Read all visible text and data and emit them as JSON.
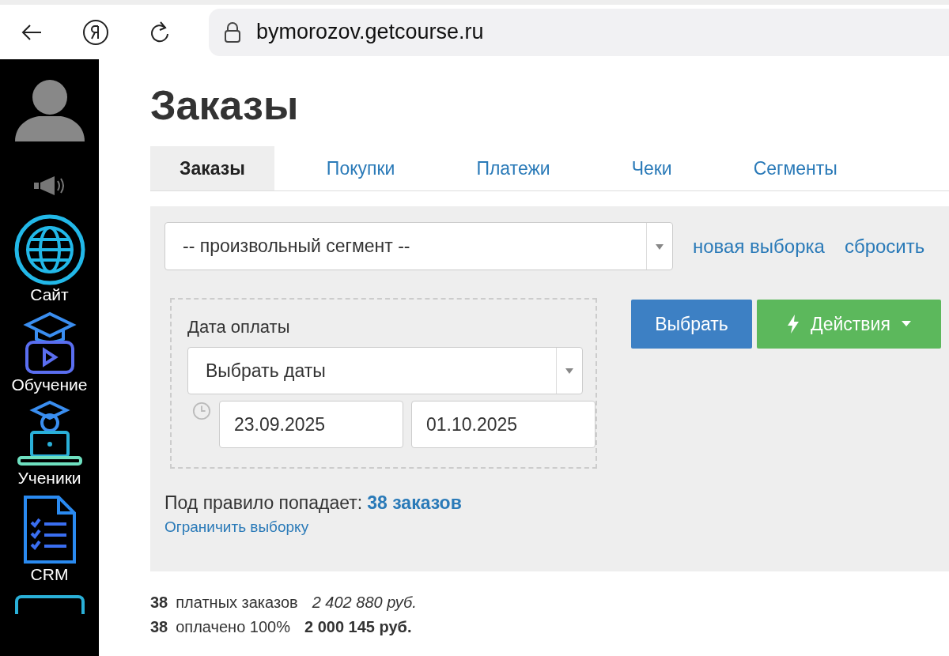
{
  "browser": {
    "url": "bymorozov.getcourse.ru"
  },
  "sidebar": {
    "items": [
      {
        "label": "Сайт",
        "kind": "globe"
      },
      {
        "label": "Обучение",
        "kind": "course"
      },
      {
        "label": "Ученики",
        "kind": "students"
      },
      {
        "label": "CRM",
        "kind": "crm"
      }
    ]
  },
  "page": {
    "title": "Заказы"
  },
  "tabs": [
    {
      "label": "Заказы",
      "selected": true
    },
    {
      "label": "Покупки",
      "selected": false
    },
    {
      "label": "Платежи",
      "selected": false
    },
    {
      "label": "Чеки",
      "selected": false
    },
    {
      "label": "Сегменты",
      "selected": false
    }
  ],
  "filter": {
    "segment": "-- произвольный сегмент --",
    "links": [
      "новая выборка",
      "сбросить"
    ],
    "date_block": {
      "label": "Дата оплаты",
      "select": "Выбрать даты",
      "from": "23.09.2025",
      "to": "01.10.2025"
    },
    "buttons": [
      {
        "label": "Выбрать",
        "kind": "primary"
      },
      {
        "label": "Действия",
        "kind": "actions"
      }
    ],
    "rule_text": "Под правило попадает:",
    "rule_count": "38 заказов",
    "limit_link": "Ограничить выборку"
  },
  "stats": [
    {
      "count": "38",
      "label": "платных заказов",
      "amount": "2 402 880 руб.",
      "kind": "total"
    },
    {
      "count": "38",
      "label": "оплачено 100%",
      "amount": "2 000 145 руб.",
      "kind": "paid"
    }
  ]
}
